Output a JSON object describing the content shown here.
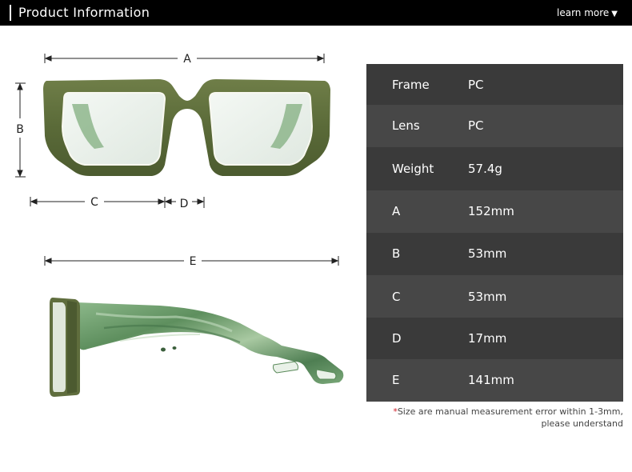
{
  "header": {
    "title": "Product Information",
    "learn_more": "learn more",
    "caret": "▼"
  },
  "dimension_labels": {
    "a": "A",
    "b": "B",
    "c": "C",
    "d": "D",
    "e": "E"
  },
  "specs": [
    {
      "key": "Frame",
      "value": "PC"
    },
    {
      "key": "Lens",
      "value": "PC"
    },
    {
      "key": "Weight",
      "value": "57.4g"
    },
    {
      "key": "A",
      "value": "152mm"
    },
    {
      "key": "B",
      "value": "53mm"
    },
    {
      "key": "C",
      "value": "53mm"
    },
    {
      "key": "D",
      "value": "17mm"
    },
    {
      "key": "E",
      "value": "141mm"
    }
  ],
  "note": {
    "star": "*",
    "line1": "Size are manual measurement error within 1-3mm,",
    "line2": "please understand"
  },
  "colors": {
    "frame_olive": "#5e6e3e",
    "temple_green": "#6c9a6a",
    "table_dark": "#3a3a3a",
    "table_light": "#474747",
    "note_star": "#d0202a"
  }
}
